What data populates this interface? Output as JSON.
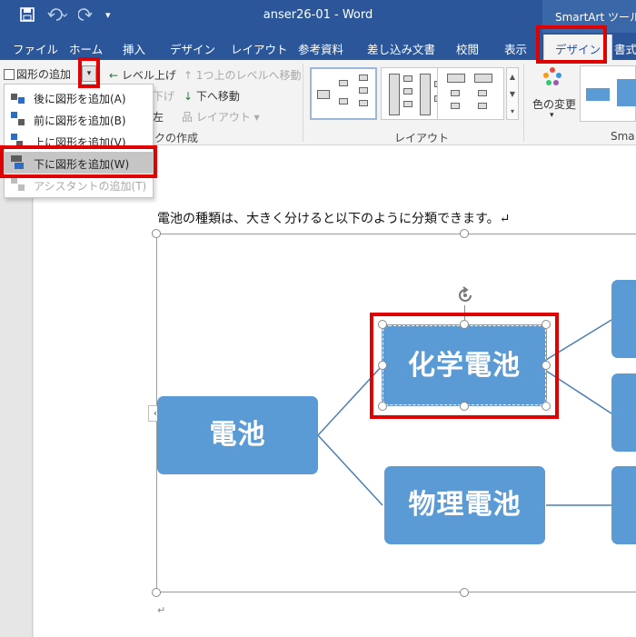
{
  "titlebar": {
    "title": "anser26-01  -  Word",
    "contextual_tools": "SmartArt ツール",
    "save_icon": "save-icon",
    "undo_icon": "undo-icon",
    "redo_icon": "redo-icon",
    "customize_icon": "customize-qat-icon"
  },
  "tabs": [
    {
      "label": "ファイル"
    },
    {
      "label": "ホーム"
    },
    {
      "label": "挿入"
    },
    {
      "label": "デザイン"
    },
    {
      "label": "レイアウト"
    },
    {
      "label": "参考資料"
    },
    {
      "label": "差し込み文書"
    },
    {
      "label": "校閲"
    },
    {
      "label": "表示"
    },
    {
      "label": "デザイン"
    },
    {
      "label": "書式"
    }
  ],
  "ribbon": {
    "add_shape": "図形の追加",
    "promote": "レベル上げ",
    "move_up": "1つ上のレベルへ移動",
    "demote": "下げ",
    "move_down": "下へ移動",
    "right_to_left": "左",
    "layout_btn": "レイアウト",
    "create_graphic_group": "クの作成",
    "layouts_group": "レイアウト",
    "change_colors": "色の変更",
    "styles_group": "Sma"
  },
  "menu": {
    "items": [
      {
        "label": "後に図形を追加(A)"
      },
      {
        "label": "前に図形を追加(B)"
      },
      {
        "label": "上に図形を追加(V)"
      },
      {
        "label": "下に図形を追加(W)"
      },
      {
        "label": "アシスタントの追加(T)"
      }
    ]
  },
  "document": {
    "text": "電池の種類は、大きく分けると以下のように分類できます。↵",
    "para_mark": "↵"
  },
  "smartart": {
    "root": "電池",
    "child1": "化学電池",
    "child2": "物理電池",
    "expander": "‹"
  },
  "colors": {
    "accent": "#2b579a",
    "node": "#5b9bd5",
    "highlight": "#e00000"
  }
}
